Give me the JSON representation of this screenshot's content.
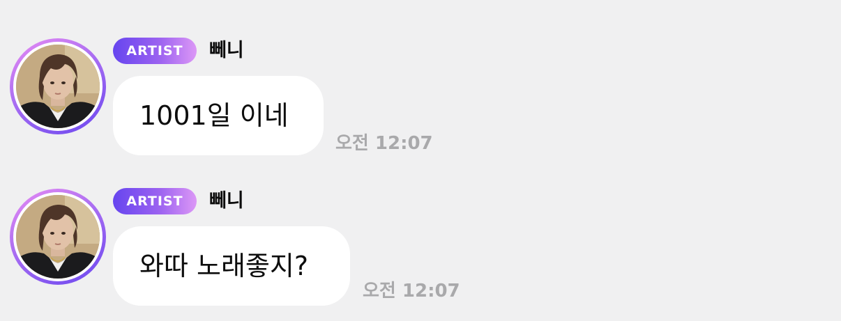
{
  "messages": [
    {
      "badge": "ARTIST",
      "sender": "뻬니",
      "text": "1001일 이네",
      "time": "오전 12:07"
    },
    {
      "badge": "ARTIST",
      "sender": "뻬니",
      "text": "와따 노래좋지?",
      "time": "오전 12:07"
    }
  ],
  "colors": {
    "background": "#f0f0f1",
    "badge_gradient": [
      "#6645ef",
      "#dc97f6"
    ],
    "bubble": "#ffffff",
    "timestamp": "#a9a9ab",
    "avatar_ring": [
      "#e98cf3",
      "#6a47ef"
    ]
  },
  "icons": {
    "avatar": "profile-photo"
  }
}
